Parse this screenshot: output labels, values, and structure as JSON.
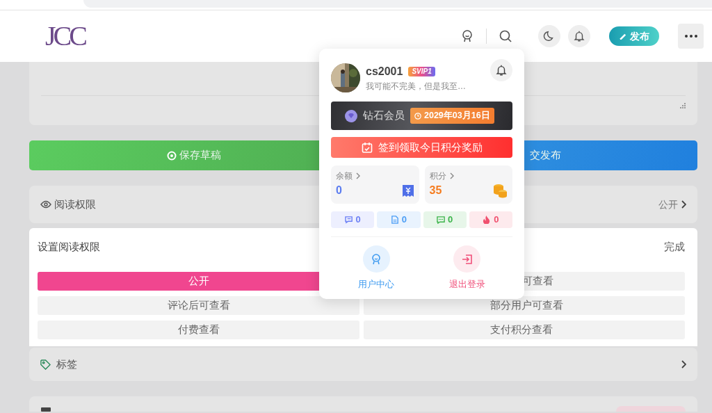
{
  "header": {
    "logo": "JCC",
    "publish_button": "发布"
  },
  "actions": [
    {
      "kind": "draft",
      "label": "保存草稿"
    },
    {
      "kind": "submit",
      "label": "交发布"
    }
  ],
  "read_permission": {
    "label": "阅读权限",
    "value": "公开"
  },
  "permission_sheet": {
    "title": "设置阅读权限",
    "done": "完成",
    "options": [
      {
        "label": "公开",
        "selected": true
      },
      {
        "label": "可查看",
        "selected": false
      },
      {
        "label": "评论后可查看",
        "selected": false
      },
      {
        "label": "部分用户可查看",
        "selected": false
      },
      {
        "label": "付费查看",
        "selected": false
      },
      {
        "label": "支付积分查看",
        "selected": false
      }
    ]
  },
  "tags": {
    "label": "标签"
  },
  "user_menu": {
    "username": "cs2001",
    "vip_badge": "SVIP1",
    "signature": "我可能不完美，但是我至…",
    "membership": {
      "name": "钻石会员",
      "expires": "2029年03月16日"
    },
    "checkin_button": "签到领取今日积分奖励",
    "balances": [
      {
        "kind": "balance",
        "label": "余额",
        "value": "0"
      },
      {
        "kind": "points",
        "label": "积分",
        "value": "35"
      }
    ],
    "counters": [
      {
        "kind": "comment",
        "value": "0",
        "color": "#6b7ff5"
      },
      {
        "kind": "post",
        "value": "0",
        "color": "#4d9ef5"
      },
      {
        "kind": "message",
        "value": "0",
        "color": "#3cb44b"
      },
      {
        "kind": "hot",
        "value": "0",
        "color": "#f0506e"
      }
    ],
    "links": [
      {
        "kind": "user",
        "label": "用户中心"
      },
      {
        "kind": "logout",
        "label": "退出登录"
      }
    ]
  }
}
